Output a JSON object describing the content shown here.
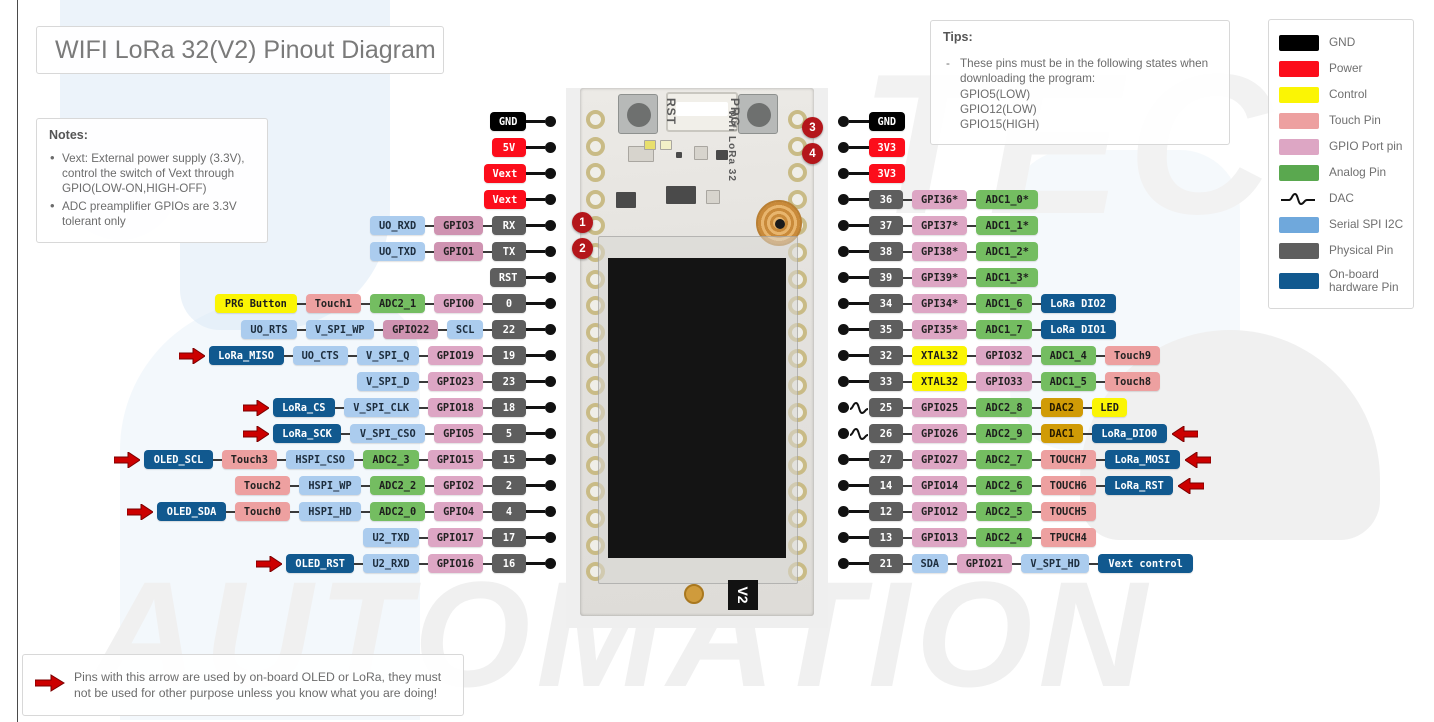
{
  "title": "WIFI LoRa 32(V2) Pinout Diagram",
  "notes": {
    "heading": "Notes:",
    "items": [
      "Vext: External power supply (3.3V), control the switch of Vext through GPIO(LOW-ON,HIGH-OFF)",
      "ADC preamplifier GPIOs are 3.3V tolerant only"
    ]
  },
  "tips": {
    "heading": "Tips:",
    "body": "These pins must be in the following states when downloading the program:\nGPIO5(LOW)\nGPIO12(LOW)\nGPIO15(HIGH)"
  },
  "legend": {
    "items": [
      {
        "label": "GND",
        "color": "#000000",
        "type": "swatch"
      },
      {
        "label": "Power",
        "color": "#fc0d1b",
        "type": "swatch"
      },
      {
        "label": "Control",
        "color": "#fbf504",
        "type": "swatch"
      },
      {
        "label": "Touch Pin",
        "color": "#eda0a0",
        "type": "swatch"
      },
      {
        "label": "GPIO Port pin",
        "color": "#dda6c4",
        "type": "swatch"
      },
      {
        "label": "Analog Pin",
        "color": "#5aa84f",
        "type": "swatch"
      },
      {
        "label": "DAC",
        "color": "#000000",
        "type": "wave"
      },
      {
        "label": "Serial SPI I2C",
        "color": "#6fa8dc",
        "type": "swatch"
      },
      {
        "label": "Physical Pin",
        "color": "#5e5e5e",
        "type": "swatch"
      },
      {
        "label": "On-board hardware Pin",
        "color": "#11598f",
        "type": "swatch"
      }
    ]
  },
  "footnote": "Pins with this arrow are used by on-board OLED or LoRa, they must not be used for other purpose unless you know what you are doing!",
  "board": {
    "silk_rst": "RST",
    "silk_prg": "PRG",
    "silk_name": "Wifi LoRa 32",
    "version": "V2",
    "callouts": [
      "1",
      "2",
      "3",
      "4"
    ]
  },
  "left_pins": [
    {
      "arrow": false,
      "chips": [
        {
          "t": "GND",
          "c": "c-gnd"
        }
      ]
    },
    {
      "arrow": false,
      "chips": [
        {
          "t": "5V",
          "c": "c-pwr"
        }
      ]
    },
    {
      "arrow": false,
      "chips": [
        {
          "t": "Vext",
          "c": "c-pwr"
        }
      ]
    },
    {
      "arrow": false,
      "chips": [
        {
          "t": "Vext",
          "c": "c-pwr"
        }
      ]
    },
    {
      "arrow": false,
      "chips": [
        {
          "t": "UO_RXD",
          "c": "c-spi"
        },
        {
          "t": "GPIO3",
          "c": "c-gpio2"
        },
        {
          "t": "RX",
          "c": "c-phys"
        }
      ]
    },
    {
      "arrow": false,
      "chips": [
        {
          "t": "UO_TXD",
          "c": "c-spi"
        },
        {
          "t": "GPIO1",
          "c": "c-gpio2"
        },
        {
          "t": "TX",
          "c": "c-phys"
        }
      ]
    },
    {
      "arrow": false,
      "chips": [
        {
          "t": "RST",
          "c": "c-phys"
        }
      ]
    },
    {
      "arrow": false,
      "chips": [
        {
          "t": "PRG Button",
          "c": "c-ctrl"
        },
        {
          "t": "Touch1",
          "c": "c-touch"
        },
        {
          "t": "ADC2_1",
          "c": "c-analog"
        },
        {
          "t": "GPIO0",
          "c": "c-gpio"
        },
        {
          "t": "0",
          "c": "c-phys"
        }
      ]
    },
    {
      "arrow": false,
      "chips": [
        {
          "t": "UO_RTS",
          "c": "c-spi"
        },
        {
          "t": "V_SPI_WP",
          "c": "c-spi"
        },
        {
          "t": "GPIO22",
          "c": "c-gpio2"
        },
        {
          "t": "SCL",
          "c": "c-spi"
        },
        {
          "t": "22",
          "c": "c-phys"
        }
      ]
    },
    {
      "arrow": true,
      "chips": [
        {
          "t": "LoRa_MISO",
          "c": "c-board"
        },
        {
          "t": "UO_CTS",
          "c": "c-spi"
        },
        {
          "t": "V_SPI_Q",
          "c": "c-spi"
        },
        {
          "t": "GPIO19",
          "c": "c-gpio"
        },
        {
          "t": "19",
          "c": "c-phys"
        }
      ]
    },
    {
      "arrow": false,
      "chips": [
        {
          "t": "V_SPI_D",
          "c": "c-spi"
        },
        {
          "t": "GPIO23",
          "c": "c-gpio"
        },
        {
          "t": "23",
          "c": "c-phys"
        }
      ]
    },
    {
      "arrow": true,
      "chips": [
        {
          "t": "LoRa_CS",
          "c": "c-board"
        },
        {
          "t": "V_SPI_CLK",
          "c": "c-spi"
        },
        {
          "t": "GPIO18",
          "c": "c-gpio"
        },
        {
          "t": "18",
          "c": "c-phys"
        }
      ]
    },
    {
      "arrow": true,
      "chips": [
        {
          "t": "LoRa_SCK",
          "c": "c-board"
        },
        {
          "t": "V_SPI_CSO",
          "c": "c-spi"
        },
        {
          "t": "GPIO5",
          "c": "c-gpio"
        },
        {
          "t": "5",
          "c": "c-phys"
        }
      ]
    },
    {
      "arrow": true,
      "chips": [
        {
          "t": "OLED_SCL",
          "c": "c-board"
        },
        {
          "t": "Touch3",
          "c": "c-touch"
        },
        {
          "t": "HSPI_CSO",
          "c": "c-spi"
        },
        {
          "t": "ADC2_3",
          "c": "c-analog"
        },
        {
          "t": "GPIO15",
          "c": "c-gpio"
        },
        {
          "t": "15",
          "c": "c-phys"
        }
      ]
    },
    {
      "arrow": false,
      "chips": [
        {
          "t": "Touch2",
          "c": "c-touch"
        },
        {
          "t": "HSPI_WP",
          "c": "c-spi"
        },
        {
          "t": "ADC2_2",
          "c": "c-analog"
        },
        {
          "t": "GPIO2",
          "c": "c-gpio"
        },
        {
          "t": "2",
          "c": "c-phys"
        }
      ]
    },
    {
      "arrow": true,
      "chips": [
        {
          "t": "OLED_SDA",
          "c": "c-board"
        },
        {
          "t": "Touch0",
          "c": "c-touch"
        },
        {
          "t": "HSPI_HD",
          "c": "c-spi"
        },
        {
          "t": "ADC2_0",
          "c": "c-analog"
        },
        {
          "t": "GPIO4",
          "c": "c-gpio"
        },
        {
          "t": "4",
          "c": "c-phys"
        }
      ]
    },
    {
      "arrow": false,
      "chips": [
        {
          "t": "U2_TXD",
          "c": "c-spi"
        },
        {
          "t": "GPIO17",
          "c": "c-gpio"
        },
        {
          "t": "17",
          "c": "c-phys"
        }
      ]
    },
    {
      "arrow": true,
      "chips": [
        {
          "t": "OLED_RST",
          "c": "c-board"
        },
        {
          "t": "U2_RXD",
          "c": "c-spi"
        },
        {
          "t": "GPIO16",
          "c": "c-gpio"
        },
        {
          "t": "16",
          "c": "c-phys"
        }
      ]
    }
  ],
  "right_pins": [
    {
      "dac": false,
      "arrow": false,
      "chips": [
        {
          "t": "GND",
          "c": "c-gnd"
        }
      ]
    },
    {
      "dac": false,
      "arrow": false,
      "chips": [
        {
          "t": "3V3",
          "c": "c-pwr"
        }
      ]
    },
    {
      "dac": false,
      "arrow": false,
      "chips": [
        {
          "t": "3V3",
          "c": "c-pwr"
        }
      ]
    },
    {
      "dac": false,
      "arrow": false,
      "chips": [
        {
          "t": "36",
          "c": "c-phys"
        },
        {
          "t": "GPI36*",
          "c": "c-gpio"
        },
        {
          "t": "ADC1_0*",
          "c": "c-analog"
        }
      ]
    },
    {
      "dac": false,
      "arrow": false,
      "chips": [
        {
          "t": "37",
          "c": "c-phys"
        },
        {
          "t": "GPI37*",
          "c": "c-gpio"
        },
        {
          "t": "ADC1_1*",
          "c": "c-analog"
        }
      ]
    },
    {
      "dac": false,
      "arrow": false,
      "chips": [
        {
          "t": "38",
          "c": "c-phys"
        },
        {
          "t": "GPI38*",
          "c": "c-gpio"
        },
        {
          "t": "ADC1_2*",
          "c": "c-analog"
        }
      ]
    },
    {
      "dac": false,
      "arrow": false,
      "chips": [
        {
          "t": "39",
          "c": "c-phys"
        },
        {
          "t": "GPI39*",
          "c": "c-gpio"
        },
        {
          "t": "ADC1_3*",
          "c": "c-analog"
        }
      ]
    },
    {
      "dac": false,
      "arrow": false,
      "chips": [
        {
          "t": "34",
          "c": "c-phys"
        },
        {
          "t": "GPI34*",
          "c": "c-gpio"
        },
        {
          "t": "ADC1_6",
          "c": "c-analog"
        },
        {
          "t": "LoRa DIO2",
          "c": "c-board"
        }
      ]
    },
    {
      "dac": false,
      "arrow": false,
      "chips": [
        {
          "t": "35",
          "c": "c-phys"
        },
        {
          "t": "GPI35*",
          "c": "c-gpio"
        },
        {
          "t": "ADC1_7",
          "c": "c-analog"
        },
        {
          "t": "LoRa DIO1",
          "c": "c-board"
        }
      ]
    },
    {
      "dac": false,
      "arrow": false,
      "chips": [
        {
          "t": "32",
          "c": "c-phys"
        },
        {
          "t": "XTAL32",
          "c": "c-ctrl"
        },
        {
          "t": "GPIO32",
          "c": "c-gpio"
        },
        {
          "t": "ADC1_4",
          "c": "c-analog"
        },
        {
          "t": "Touch9",
          "c": "c-touch"
        }
      ]
    },
    {
      "dac": false,
      "arrow": false,
      "chips": [
        {
          "t": "33",
          "c": "c-phys"
        },
        {
          "t": "XTAL32",
          "c": "c-ctrl"
        },
        {
          "t": "GPIO33",
          "c": "c-gpio"
        },
        {
          "t": "ADC1_5",
          "c": "c-analog"
        },
        {
          "t": "Touch8",
          "c": "c-touch"
        }
      ]
    },
    {
      "dac": true,
      "arrow": false,
      "chips": [
        {
          "t": "25",
          "c": "c-phys"
        },
        {
          "t": "GPIO25",
          "c": "c-gpio"
        },
        {
          "t": "ADC2_8",
          "c": "c-analog"
        },
        {
          "t": "DAC2",
          "c": "c-dac"
        },
        {
          "t": "LED",
          "c": "c-ctrl"
        }
      ]
    },
    {
      "dac": true,
      "arrow": true,
      "chips": [
        {
          "t": "26",
          "c": "c-phys"
        },
        {
          "t": "GPIO26",
          "c": "c-gpio"
        },
        {
          "t": "ADC2_9",
          "c": "c-analog"
        },
        {
          "t": "DAC1",
          "c": "c-dac"
        },
        {
          "t": "LoRa_DIO0",
          "c": "c-board"
        }
      ]
    },
    {
      "dac": false,
      "arrow": true,
      "chips": [
        {
          "t": "27",
          "c": "c-phys"
        },
        {
          "t": "GPIO27",
          "c": "c-gpio"
        },
        {
          "t": "ADC2_7",
          "c": "c-analog"
        },
        {
          "t": "TOUCH7",
          "c": "c-touch"
        },
        {
          "t": "LoRa_MOSI",
          "c": "c-board"
        }
      ]
    },
    {
      "dac": false,
      "arrow": true,
      "chips": [
        {
          "t": "14",
          "c": "c-phys"
        },
        {
          "t": "GPIO14",
          "c": "c-gpio"
        },
        {
          "t": "ADC2_6",
          "c": "c-analog"
        },
        {
          "t": "TOUCH6",
          "c": "c-touch"
        },
        {
          "t": "LoRa_RST",
          "c": "c-board"
        }
      ]
    },
    {
      "dac": false,
      "arrow": false,
      "chips": [
        {
          "t": "12",
          "c": "c-phys"
        },
        {
          "t": "GPIO12",
          "c": "c-gpio"
        },
        {
          "t": "ADC2_5",
          "c": "c-analog"
        },
        {
          "t": "TOUCH5",
          "c": "c-touch"
        }
      ]
    },
    {
      "dac": false,
      "arrow": false,
      "chips": [
        {
          "t": "13",
          "c": "c-phys"
        },
        {
          "t": "GPIO13",
          "c": "c-gpio"
        },
        {
          "t": "ADC2_4",
          "c": "c-analog"
        },
        {
          "t": "TPUCH4",
          "c": "c-touch"
        }
      ]
    },
    {
      "dac": false,
      "arrow": false,
      "chips": [
        {
          "t": "21",
          "c": "c-phys"
        },
        {
          "t": "SDA",
          "c": "c-spi"
        },
        {
          "t": "GPIO21",
          "c": "c-gpio"
        },
        {
          "t": "V_SPI_HD",
          "c": "c-spi"
        },
        {
          "t": "Vext control",
          "c": "c-board"
        }
      ]
    }
  ],
  "watermark": {
    "text": "AUTOMATION"
  }
}
